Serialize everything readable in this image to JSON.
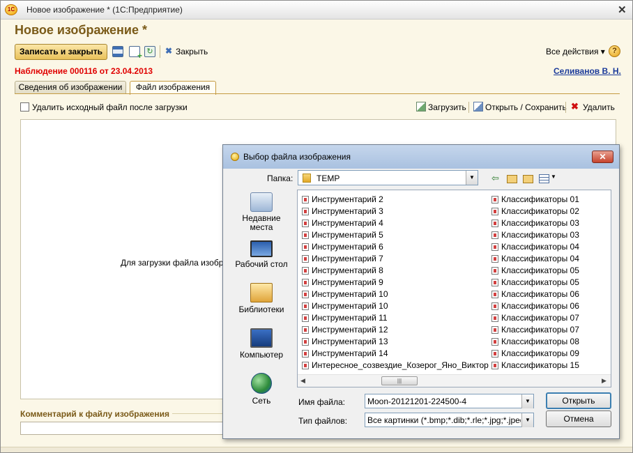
{
  "window": {
    "title": "Новое изображение * (1С:Предприятие)",
    "close_icon": "close-icon",
    "app_icon_text": "1С"
  },
  "form": {
    "title": "Новое изображение *",
    "observation": "Наблюдение 000116 от 23.04.2013",
    "author": "Селиванов В. Н."
  },
  "toolbar": {
    "save_close_label": "Записать и закрыть",
    "close_label": "Закрыть",
    "all_actions_label": "Все действия ▾",
    "help_label": "?"
  },
  "tabs": [
    {
      "label": "Сведения об изображении"
    },
    {
      "label": "Файл изображения"
    }
  ],
  "file_tab": {
    "delete_after_upload_label": "Удалить исходный файл после загрузки",
    "upload_label": "Загрузить",
    "open_save_label": "Открыть / Сохранить",
    "delete_label": "Удалить",
    "hint": "Для загрузки файла изображ",
    "comment_title": "Комментарий к файлу изображения"
  },
  "dialog": {
    "title": "Выбор файла изображения",
    "close_label": "✕",
    "folder_label": "Папка:",
    "folder_value": "TEMP",
    "places": [
      {
        "label": "Недавние места",
        "icon": "recent-places-icon"
      },
      {
        "label": "Рабочий стол",
        "icon": "desktop-icon"
      },
      {
        "label": "Библиотеки",
        "icon": "libraries-icon"
      },
      {
        "label": "Компьютер",
        "icon": "computer-icon"
      },
      {
        "label": "Сеть",
        "icon": "network-icon"
      }
    ],
    "files_col1": [
      "Инструментарий 2",
      "Инструментарий 3",
      "Инструментарий 4",
      "Инструментарий 5",
      "Инструментарий 6",
      "Инструментарий 7",
      "Инструментарий 8",
      "Инструментарий 9",
      "Инструментарий 10",
      "Инструментарий 10",
      "Инструментарий 11",
      "Инструментарий 12",
      "Инструментарий 13",
      "Инструментарий 14",
      "Интересное_созвездие_Козерог_Яно_Виктор"
    ],
    "files_col2": [
      "Классификаторы 01",
      "Классификаторы 02",
      "Классификаторы 03",
      "Классификаторы 03",
      "Классификаторы 04",
      "Классификаторы 04",
      "Классификаторы 05",
      "Классификаторы 05",
      "Классификаторы 06",
      "Классификаторы 06",
      "Классификаторы 07",
      "Классификаторы 07",
      "Классификаторы 08",
      "Классификаторы 09",
      "Классификаторы 15"
    ],
    "filename_label": "Имя файла:",
    "filename_value": "Moon-20121201-224500-4",
    "filetype_label": "Тип файлов:",
    "filetype_value": "Все картинки (*.bmp;*.dib;*.rle;*.jpg;*.jpeg;*.tif;",
    "open_label": "Открыть",
    "cancel_label": "Отмена"
  }
}
